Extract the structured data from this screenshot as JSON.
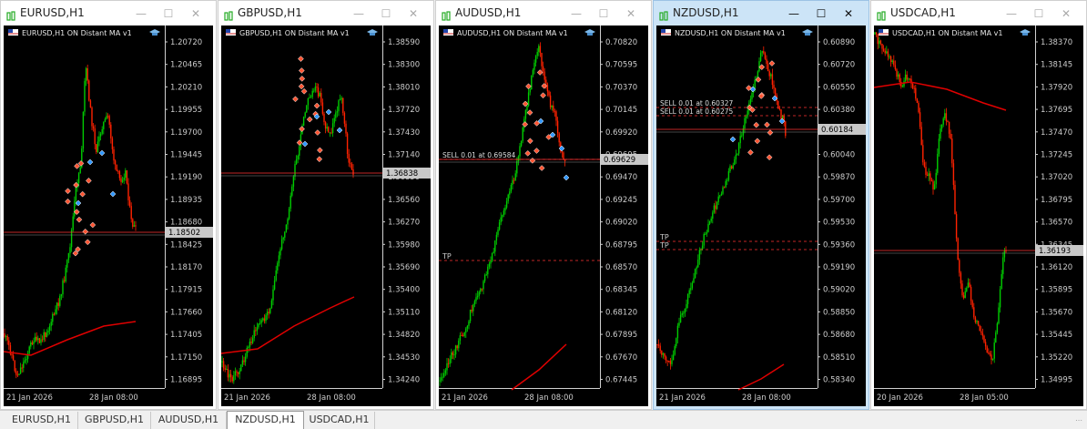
{
  "colors": {
    "bull": "#00cc00",
    "bear": "#ff2200",
    "ma": "#e00000",
    "price_line": "#ff3333",
    "sell_marker": "#ff5533",
    "buy_marker": "#3399ff",
    "active_title_bg": "#cce4f7",
    "chart_bg": "#000000",
    "axis_text": "#cccccc",
    "app_icon": "#22aa22"
  },
  "icons": {
    "app": "mt-chart-icon",
    "minimize": "minimize-icon",
    "maximize": "maximize-icon",
    "close": "close-icon",
    "hat": "graduation-cap-icon",
    "flag": "flag-icon"
  },
  "windows": [
    {
      "title": "EURUSD,H1",
      "active": false,
      "indicator_label": "EURUSD,H1 ON Distant MA v1",
      "price_ticks": [
        "1.20720",
        "1.20465",
        "1.20210",
        "1.19955",
        "1.19700",
        "1.19445",
        "1.19190",
        "1.18935",
        "1.18680",
        "1.18425",
        "1.18170",
        "1.17915",
        "1.17660",
        "1.17405",
        "1.17150",
        "1.16895"
      ],
      "current_price": "1.18502",
      "time_labels": [
        "21 Jan 2026",
        "28 Jan 08:00"
      ],
      "trade_labels": [],
      "tp_labels": []
    },
    {
      "title": "GBPUSD,H1",
      "active": false,
      "indicator_label": "GBPUSD,H1 ON Distant MA v1",
      "price_ticks": [
        "1.38590",
        "1.38300",
        "1.38010",
        "1.37720",
        "1.37430",
        "1.37140",
        "1.36850",
        "1.36560",
        "1.36270",
        "1.35980",
        "1.35690",
        "1.35400",
        "1.35110",
        "1.34820",
        "1.34530",
        "1.34240"
      ],
      "current_price": "1.36838",
      "time_labels": [
        "21 Jan 2026",
        "28 Jan 08:00"
      ],
      "trade_labels": [],
      "tp_labels": []
    },
    {
      "title": "AUDUSD,H1",
      "active": false,
      "indicator_label": "AUDUSD,H1 ON Distant MA v1",
      "price_ticks": [
        "0.70820",
        "0.70595",
        "0.70370",
        "0.70145",
        "0.69920",
        "0.69695",
        "0.69470",
        "0.69245",
        "0.69020",
        "0.68795",
        "0.68570",
        "0.68345",
        "0.68120",
        "0.67895",
        "0.67670",
        "0.67445"
      ],
      "current_price": "0.69629",
      "time_labels": [
        "21 Jan 2026",
        "28 Jan 08:00"
      ],
      "trade_labels": [
        "SELL 0.01 at 0.69584"
      ],
      "tp_labels": [
        "TP"
      ]
    },
    {
      "title": "NZDUSD,H1",
      "active": true,
      "indicator_label": "NZDUSD,H1 ON Distant MA v1",
      "price_ticks": [
        "0.60890",
        "0.60720",
        "0.60550",
        "0.60380",
        "0.60210",
        "0.60040",
        "0.59870",
        "0.59700",
        "0.59530",
        "0.59360",
        "0.59190",
        "0.59020",
        "0.58850",
        "0.58680",
        "0.58510",
        "0.58340"
      ],
      "current_price": "0.60184",
      "time_labels": [
        "21 Jan 2026",
        "28 Jan 08:00"
      ],
      "trade_labels": [
        "SELL 0.01 at 0.60327",
        "SELL 0.01 at 0.60275"
      ],
      "tp_labels": [
        "TP",
        "TP"
      ]
    },
    {
      "title": "USDCAD,H1",
      "active": false,
      "indicator_label": "USDCAD,H1 ON Distant MA v1",
      "price_ticks": [
        "1.38370",
        "1.38145",
        "1.37920",
        "1.37695",
        "1.37470",
        "1.37245",
        "1.37020",
        "1.36795",
        "1.36570",
        "1.36345",
        "1.36120",
        "1.35895",
        "1.35670",
        "1.35445",
        "1.35220",
        "1.34995"
      ],
      "current_price": "1.36193",
      "time_labels": [
        "20 Jan 2026",
        "28 Jan 05:00"
      ],
      "trade_labels": [],
      "tp_labels": []
    }
  ],
  "tabs": [
    "EURUSD,H1",
    "GBPUSD,H1",
    "AUDUSD,H1",
    "NZDUSD,H1",
    "USDCAD,H1"
  ],
  "active_tab": "NZDUSD,H1"
}
